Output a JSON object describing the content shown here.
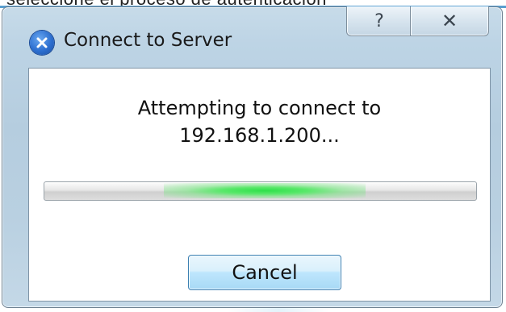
{
  "background": {
    "partial_text": "seleccione el proceso de autenticación"
  },
  "window": {
    "title": "Connect to Server",
    "app_icon": "connect-x-icon",
    "title_buttons": {
      "help_glyph": "?",
      "close_glyph": "✕"
    }
  },
  "dialog": {
    "message_line1": "Attempting to connect to",
    "message_line2": "192.168.1.200...",
    "progress_state": "indeterminate",
    "cancel_label": "Cancel"
  },
  "colors": {
    "accent_blue": "#2d6fd0",
    "progress_green": "#2fe04a",
    "button_border": "#3c7fb1"
  }
}
